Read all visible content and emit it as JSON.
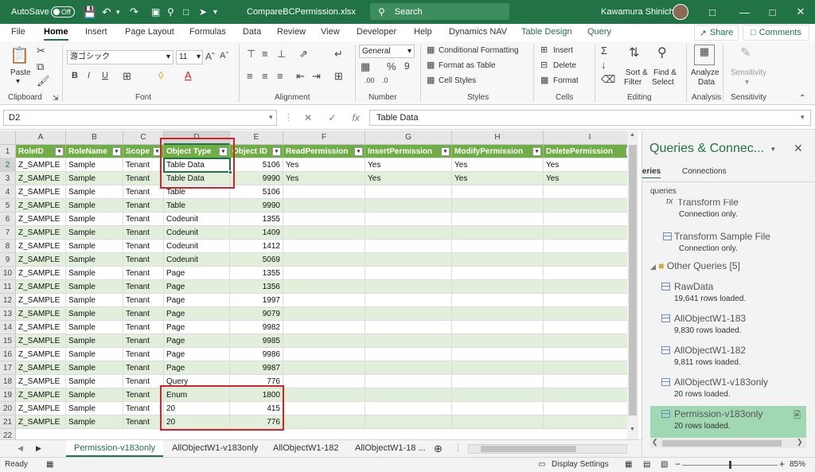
{
  "titlebar": {
    "autosave_label": "AutoSave",
    "autosave_state": "Off",
    "filename": "CompareBCPermission.xlsx",
    "search_placeholder": "Search",
    "user_name": "Kawamura Shinichi"
  },
  "ribbon_tabs": [
    "File",
    "Home",
    "Insert",
    "Page Layout",
    "Formulas",
    "Data",
    "Review",
    "View",
    "Developer",
    "Help",
    "Dynamics NAV",
    "Table Design",
    "Query"
  ],
  "share_label": "Share",
  "comments_label": "Comments",
  "ribbon": {
    "paste": "Paste",
    "clipboard": "Clipboard",
    "font_name": "游ゴシック",
    "font_size": "11",
    "font": "Font",
    "alignment": "Alignment",
    "number_format": "General",
    "number": "Number",
    "conditional_formatting": "Conditional Formatting",
    "format_as_table": "Format as Table",
    "cell_styles": "Cell Styles",
    "styles": "Styles",
    "insert": "Insert",
    "delete": "Delete",
    "format": "Format",
    "cells": "Cells",
    "sort_filter_1": "Sort &",
    "sort_filter_2": "Filter",
    "find_select_1": "Find &",
    "find_select_2": "Select",
    "editing": "Editing",
    "analyze_1": "Analyze",
    "analyze_2": "Data",
    "analysis": "Analysis",
    "sensitivity": "Sensitivity",
    "sensitivity_group": "Sensitivity"
  },
  "formula_bar": {
    "name_box": "D2",
    "formula": "Table Data"
  },
  "columns": [
    "A",
    "B",
    "C",
    "D",
    "E",
    "F",
    "G",
    "H",
    "I"
  ],
  "table": {
    "headers": [
      "RoleID",
      "RoleName",
      "Scope",
      "Object Type",
      "Object ID",
      "ReadPermission",
      "InsertPermission",
      "ModifyPermission",
      "DeletePermission"
    ],
    "rows": [
      [
        "Z_SAMPLE",
        "Sample",
        "Tenant",
        "Table Data",
        "5106",
        "Yes",
        "Yes",
        "Yes",
        "Yes"
      ],
      [
        "Z_SAMPLE",
        "Sample",
        "Tenant",
        "Table Data",
        "9990",
        "Yes",
        "Yes",
        "Yes",
        "Yes"
      ],
      [
        "Z_SAMPLE",
        "Sample",
        "Tenant",
        "Table",
        "5106",
        "",
        "",
        "",
        ""
      ],
      [
        "Z_SAMPLE",
        "Sample",
        "Tenant",
        "Table",
        "9990",
        "",
        "",
        "",
        ""
      ],
      [
        "Z_SAMPLE",
        "Sample",
        "Tenant",
        "Codeunit",
        "1355",
        "",
        "",
        "",
        ""
      ],
      [
        "Z_SAMPLE",
        "Sample",
        "Tenant",
        "Codeunit",
        "1409",
        "",
        "",
        "",
        ""
      ],
      [
        "Z_SAMPLE",
        "Sample",
        "Tenant",
        "Codeunit",
        "1412",
        "",
        "",
        "",
        ""
      ],
      [
        "Z_SAMPLE",
        "Sample",
        "Tenant",
        "Codeunit",
        "5069",
        "",
        "",
        "",
        ""
      ],
      [
        "Z_SAMPLE",
        "Sample",
        "Tenant",
        "Page",
        "1355",
        "",
        "",
        "",
        ""
      ],
      [
        "Z_SAMPLE",
        "Sample",
        "Tenant",
        "Page",
        "1356",
        "",
        "",
        "",
        ""
      ],
      [
        "Z_SAMPLE",
        "Sample",
        "Tenant",
        "Page",
        "1997",
        "",
        "",
        "",
        ""
      ],
      [
        "Z_SAMPLE",
        "Sample",
        "Tenant",
        "Page",
        "9079",
        "",
        "",
        "",
        ""
      ],
      [
        "Z_SAMPLE",
        "Sample",
        "Tenant",
        "Page",
        "9982",
        "",
        "",
        "",
        ""
      ],
      [
        "Z_SAMPLE",
        "Sample",
        "Tenant",
        "Page",
        "9985",
        "",
        "",
        "",
        ""
      ],
      [
        "Z_SAMPLE",
        "Sample",
        "Tenant",
        "Page",
        "9986",
        "",
        "",
        "",
        ""
      ],
      [
        "Z_SAMPLE",
        "Sample",
        "Tenant",
        "Page",
        "9987",
        "",
        "",
        "",
        ""
      ],
      [
        "Z_SAMPLE",
        "Sample",
        "Tenant",
        "Query",
        "776",
        "",
        "",
        "",
        ""
      ],
      [
        "Z_SAMPLE",
        "Sample",
        "Tenant",
        "Enum",
        "1800",
        "",
        "",
        "",
        ""
      ],
      [
        "Z_SAMPLE",
        "Sample",
        "Tenant",
        "20",
        "415",
        "",
        "",
        "",
        ""
      ],
      [
        "Z_SAMPLE",
        "Sample",
        "Tenant",
        "20",
        "776",
        "",
        "",
        "",
        ""
      ]
    ]
  },
  "row_numbers": [
    "1",
    "2",
    "3",
    "4",
    "5",
    "6",
    "7",
    "8",
    "9",
    "10",
    "11",
    "12",
    "13",
    "14",
    "15",
    "16",
    "17",
    "18",
    "19",
    "20",
    "21",
    "22"
  ],
  "sheet_tabs": [
    "Permission-v183only",
    "AllObjectW1-v183only",
    "AllObjectW1-182",
    "AllObjectW1-18 ..."
  ],
  "status": {
    "ready": "Ready",
    "display_settings": "Display Settings",
    "zoom_minus": "−",
    "zoom_plus": "+",
    "zoom": "85%"
  },
  "queries_pane": {
    "title": "Queries & Connec...",
    "tab_queries": "Queries",
    "tab_connections": "Connections",
    "count_label": "queries",
    "items": [
      {
        "name": "Transform File",
        "sub": "Connection only.",
        "fx": true
      },
      {
        "name": "Transform Sample File",
        "sub": "Connection only.",
        "fx": false
      },
      {
        "name": "RawData",
        "sub": "19,641 rows loaded.",
        "fx": false
      },
      {
        "name": "AllObjectW1-183",
        "sub": "9,830 rows loaded.",
        "fx": false
      },
      {
        "name": "AllObjectW1-182",
        "sub": "9,811 rows loaded.",
        "fx": false
      },
      {
        "name": "AllObjectW1-v183only",
        "sub": "20 rows loaded.",
        "fx": false
      },
      {
        "name": "Permission-v183only",
        "sub": "20 rows loaded.",
        "fx": false
      }
    ],
    "folder_label": "Other Queries [5]"
  },
  "colors": {
    "excel_green": "#217346",
    "table_header": "#70ad47",
    "table_band": "#e2efda",
    "highlight_red": "#e02020",
    "query_selected": "#a0d8b3"
  }
}
